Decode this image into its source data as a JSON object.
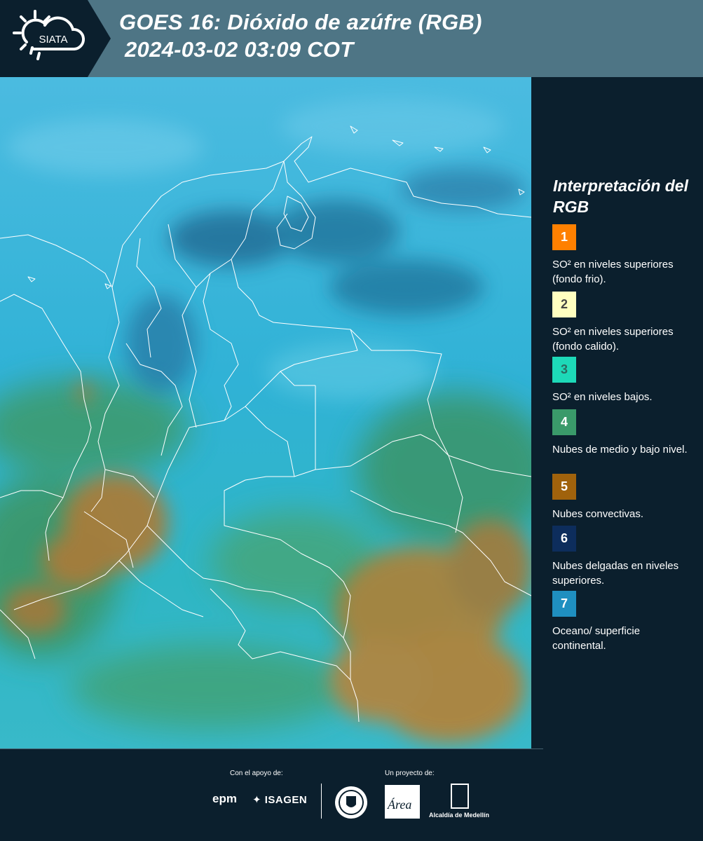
{
  "header": {
    "logo_text": "SIATA",
    "title_line1": "GOES 16: Dióxido de azúfre (RGB)",
    "title_line2": "2024-03-02 03:09 COT"
  },
  "map": {
    "background_color": "#36b3d6",
    "border_color": "#ffffff",
    "convective_color": "#a87d3a",
    "low_cloud_color": "#3e9a6a"
  },
  "legend": {
    "title": "Interpretación del RGB",
    "items": [
      {
        "number": "1",
        "color": "#ff8000",
        "text_color": "#ffffff",
        "label": "SO² en niveles superiores (fondo frio)."
      },
      {
        "number": "2",
        "color": "#ffffc0",
        "text_color": "#444444",
        "label": "SO² en niveles superiores (fondo calido)."
      },
      {
        "number": "3",
        "color": "#1dd9b8",
        "text_color": "#2a6a60",
        "label": "SO² en niveles bajos."
      },
      {
        "number": "4",
        "color": "#3a9a6a",
        "text_color": "#ffffff",
        "label": "Nubes de medio y bajo nivel."
      },
      {
        "number": "5",
        "color": "#a0620c",
        "text_color": "#ffffff",
        "label": "Nubes convectivas."
      },
      {
        "number": "6",
        "color": "#0d2d5c",
        "text_color": "#ffffff",
        "label": "Nubes delgadas en niveles superiores."
      },
      {
        "number": "7",
        "color": "#1f8fc0",
        "text_color": "#ffffff",
        "label": "Oceano/ superficie continental."
      }
    ]
  },
  "footer": {
    "support_label": "Con el apoyo de:",
    "project_label": "Un proyecto de:",
    "epm": "epm",
    "isagen": "ISAGEN",
    "area": "Área",
    "alcaldia": "Alcaldía de Medellín"
  }
}
